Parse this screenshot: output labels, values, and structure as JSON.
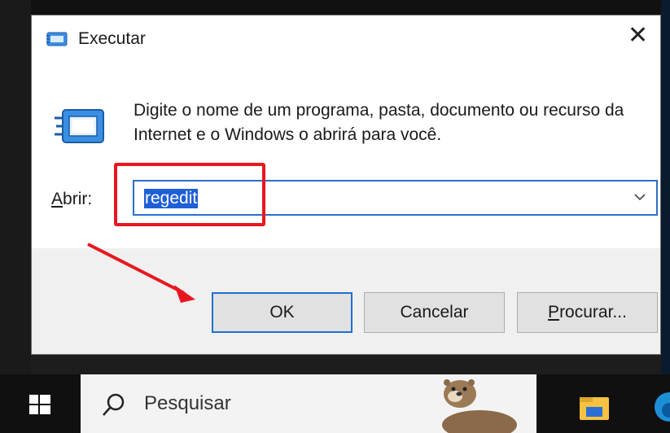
{
  "dialog": {
    "title": "Executar",
    "close_glyph": "✕",
    "description": "Digite o nome de um programa, pasta, documento ou recurso da Internet e o Windows o abrirá para você.",
    "open_label_underlined": "A",
    "open_label_rest": "brir:",
    "input_value": "regedit",
    "ok_label": "OK",
    "cancel_label": "Cancelar",
    "browse_label_underlined": "P",
    "browse_label_rest": "rocurar..."
  },
  "taskbar": {
    "search_placeholder": "Pesquisar"
  },
  "icons": {
    "title": "run-icon",
    "big": "run-icon-large",
    "close": "close-icon",
    "dropdown": "chevron-down-icon",
    "start": "windows-start-icon",
    "search": "search-icon",
    "explorer": "file-explorer-icon",
    "edge": "edge-icon"
  },
  "colors": {
    "highlight": "#e8171f",
    "selection": "#1f5fd6",
    "focus_border": "#1f6fd1"
  }
}
